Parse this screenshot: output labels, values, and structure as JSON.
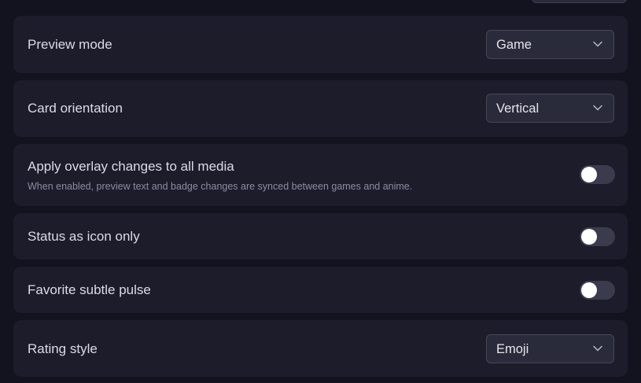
{
  "settings": {
    "preview_mode": {
      "label": "Preview mode",
      "value": "Game"
    },
    "card_orientation": {
      "label": "Card orientation",
      "value": "Vertical"
    },
    "apply_overlay": {
      "label": "Apply overlay changes to all media",
      "description": "When enabled, preview text and badge changes are synced between games and anime.",
      "enabled": false
    },
    "status_icon_only": {
      "label": "Status as icon only",
      "enabled": false
    },
    "favorite_pulse": {
      "label": "Favorite subtle pulse",
      "enabled": false
    },
    "rating_style": {
      "label": "Rating style",
      "value": "Emoji"
    }
  },
  "icons": {
    "select_chevron": "chevron-down-icon"
  },
  "colors": {
    "background": "#13131f",
    "card": "#1c1c2b",
    "select_bg": "#2a2b3a",
    "toggle_off": "#3a3b4d",
    "text_primary": "#dcdce8",
    "text_secondary": "#8b8ca3"
  }
}
